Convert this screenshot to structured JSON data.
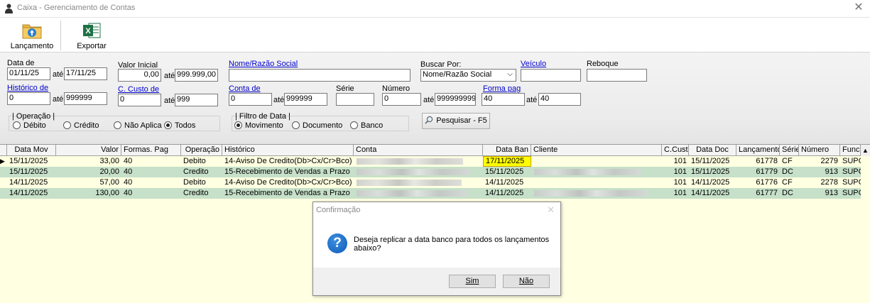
{
  "window": {
    "title": "Caixa - Gerenciamento de Contas",
    "close_glyph": "✕"
  },
  "toolbar": {
    "lancamento_label": "Lançamento",
    "exportar_label": "Exportar"
  },
  "filters": {
    "data_de_label": "Data de",
    "data_de": "01/11/25",
    "ate1": "até",
    "data_ate": "17/11/25",
    "valor_inicial_label": "Valor Inicial",
    "valor_inicial": "0,00",
    "ate2": "até",
    "valor_final": "999.999,00",
    "nome_label": "Nome/Razão Social",
    "nome_value": "",
    "buscar_por_label": "Buscar Por:",
    "buscar_por": "Nome/Razão Social",
    "buscar_arrow": "⌵",
    "veiculo_label": "Veículo",
    "veiculo_value": "",
    "reboque_label": "Reboque",
    "reboque_value": "",
    "historico_label": "Histórico de",
    "historico_de": "0",
    "ate3": "até",
    "historico_ate": "999999",
    "custo_label": "C. Custo de",
    "custo_de": "0",
    "ate4": "até",
    "custo_ate": "999",
    "conta_label": "Conta de",
    "conta_de": "0",
    "ate5": "até",
    "conta_ate": "999999",
    "serie_label": "Série",
    "serie_value": "",
    "numero_label": "Número",
    "numero_de": "0",
    "ate6": "até",
    "numero_ate": "999999999",
    "forma_label": "Forma pag",
    "forma_de": "40",
    "ate7": "até",
    "forma_ate": "40",
    "operacao_group": "| Operação |",
    "op_debito": "Débito",
    "op_credito": "Crédito",
    "op_nao_aplica": "Não Aplica",
    "op_todos": "Todos",
    "filtro_group": "| Filtro de Data |",
    "fd_movimento": "Movimento",
    "fd_documento": "Documento",
    "fd_banco": "Banco",
    "pesquisar_label": "Pesquisar - F5"
  },
  "grid": {
    "headers": {
      "data_mov": "Data Mov",
      "valor": "Valor",
      "formas": "Formas. Pag",
      "operacao": "Operação",
      "historico": "Histórico",
      "conta": "Conta",
      "data_ban": "Data Ban",
      "cliente": "Cliente",
      "ccusto": "C.Custo",
      "data_doc": "Data Doc",
      "lancamento": "Lançamento",
      "serie": "Série",
      "numero": "Número",
      "funci": "Funci"
    },
    "rows": [
      {
        "indicator": "▶",
        "data_mov": "15/11/2025",
        "valor": "33,00",
        "formas": "40",
        "operacao": "Debito",
        "historico": "14-Aviso De Credito(Db>Cx/Cr>Bco)",
        "data_ban": "17/11/2025",
        "ccusto": "101",
        "data_doc": "15/11/2025",
        "lancamento": "61778",
        "serie": "CF",
        "numero": "2279",
        "funci": "SUPC"
      },
      {
        "indicator": "",
        "data_mov": "15/11/2025",
        "valor": "20,00",
        "formas": "40",
        "operacao": "Credito",
        "historico": "15-Recebimento de Vendas a Prazo",
        "data_ban": "15/11/2025",
        "ccusto": "101",
        "data_doc": "15/11/2025",
        "lancamento": "61779",
        "serie": "DC",
        "numero": "913",
        "funci": "SUPC"
      },
      {
        "indicator": "",
        "data_mov": "14/11/2025",
        "valor": "57,00",
        "formas": "40",
        "operacao": "Debito",
        "historico": "14-Aviso De Credito(Db>Cx/Cr>Bco)",
        "data_ban": "14/11/2025",
        "ccusto": "101",
        "data_doc": "14/11/2025",
        "lancamento": "61776",
        "serie": "CF",
        "numero": "2278",
        "funci": "SUPC"
      },
      {
        "indicator": "",
        "data_mov": "14/11/2025",
        "valor": "130,00",
        "formas": "40",
        "operacao": "Credito",
        "historico": "15-Recebimento de Vendas a Prazo",
        "data_ban": "14/11/2025",
        "ccusto": "101",
        "data_doc": "14/11/2025",
        "lancamento": "61777",
        "serie": "DC",
        "numero": "913",
        "funci": "SUPC"
      }
    ],
    "scroll_up": "▲"
  },
  "dialog": {
    "title": "Confirmação",
    "close": "✕",
    "icon": "?",
    "message": "Deseja replicar a data banco para todos os lançamentos abaixo?",
    "sim": "Sim",
    "nao": "Não"
  },
  "colors": {
    "row_light": "#ffffe1",
    "row_green": "#c6e0c9",
    "selected_cell": "#ffff00"
  }
}
